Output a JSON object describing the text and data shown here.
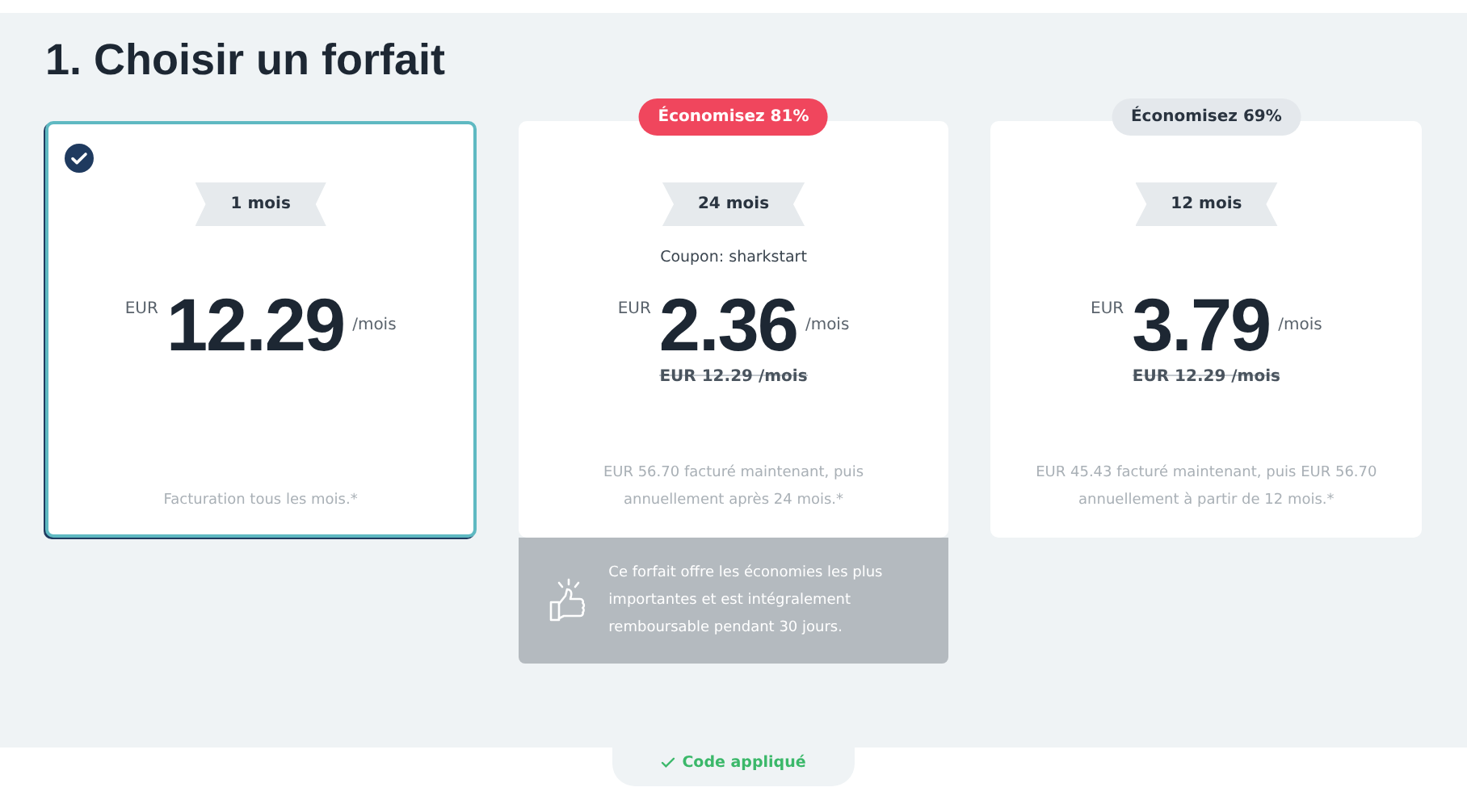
{
  "heading": "1. Choisir un forfait",
  "plans": [
    {
      "selected": true,
      "duration": "1 mois",
      "currency": "EUR",
      "price": "12.29",
      "period": "/mois",
      "note": "Facturation tous les mois.*"
    },
    {
      "selected": false,
      "badge": {
        "text": "Économisez 81%",
        "kind": "highlight"
      },
      "duration": "24 mois",
      "coupon": "Coupon: sharkstart",
      "currency": "EUR",
      "price": "2.36",
      "period": "/mois",
      "old_price": "EUR 12.29 /mois",
      "note": "EUR 56.70 facturé maintenant, puis annuellement après 24 mois.*",
      "promo": "Ce forfait offre les économies les plus importantes et est intégralement remboursable pendant 30 jours."
    },
    {
      "selected": false,
      "badge": {
        "text": "Économisez 69%",
        "kind": "muted"
      },
      "duration": "12 mois",
      "currency": "EUR",
      "price": "3.79",
      "period": "/mois",
      "old_price": "EUR 12.29 /mois",
      "note": "EUR 45.43 facturé maintenant, puis EUR 56.70 annuellement à partir de 12 mois.*"
    }
  ],
  "footer": {
    "status": "Code appliqué"
  }
}
